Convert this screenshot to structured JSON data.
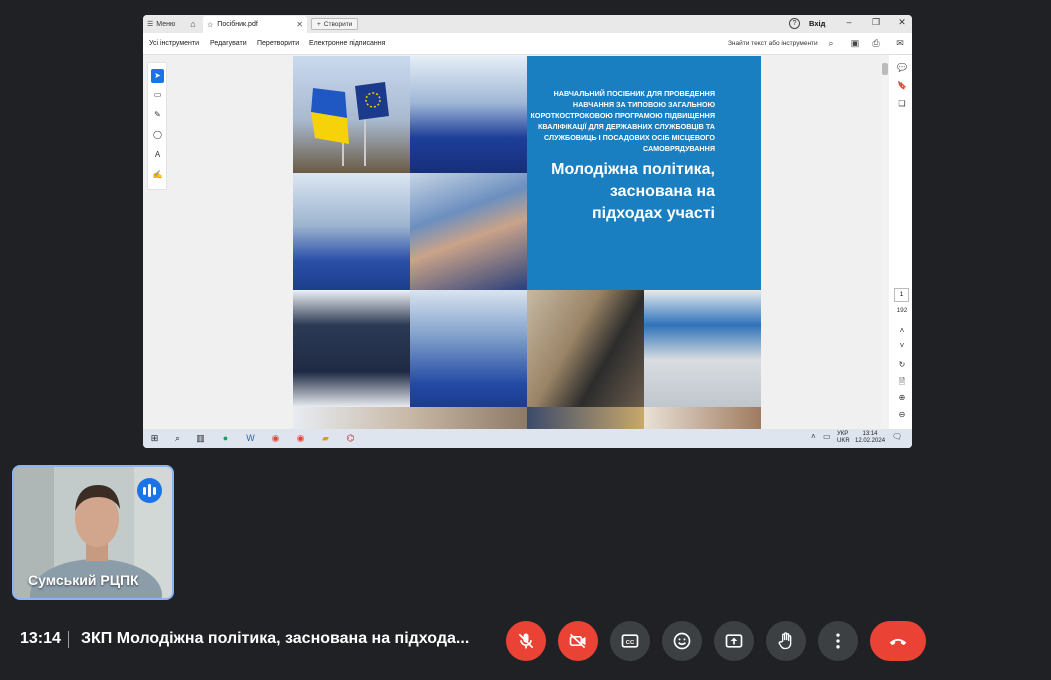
{
  "shared_screen": {
    "tabbar": {
      "menu_label": "Меню",
      "tab_label": "Посібник.pdf",
      "new_tab_label": "Створити",
      "login_label": "Вхід"
    },
    "toolbar": {
      "items": [
        "Усі інструменти",
        "Редагувати",
        "Перетворити",
        "Електронне підписання"
      ],
      "find_text": "Знайти текст або інструменти"
    },
    "document": {
      "subtitle": "Навчальний посібник для проведення навчання за типовою загальною короткостроковою програмою підвищення кваліфікації для державних службовців та службовиць і посадових осіб місцевого самоврядування",
      "title": "Молодіжна політика, заснована на підходах участі"
    },
    "pagination": {
      "current": "1",
      "total": "192"
    },
    "taskbar": {
      "lang_top": "УКР",
      "lang_bottom": "UKR",
      "time": "13:14",
      "date": "12.02.2024"
    }
  },
  "participant": {
    "name": "Сумський РЦПК"
  },
  "meeting": {
    "time": "13:14",
    "title": "ЗКП Молодіжна політика, заснована на підхода..."
  },
  "colors": {
    "meet_bg": "#202124",
    "control_bg": "#3c4043",
    "danger": "#ea4335",
    "accent_blue": "#1a73e8",
    "cover_blue": "#1a7fc1"
  }
}
